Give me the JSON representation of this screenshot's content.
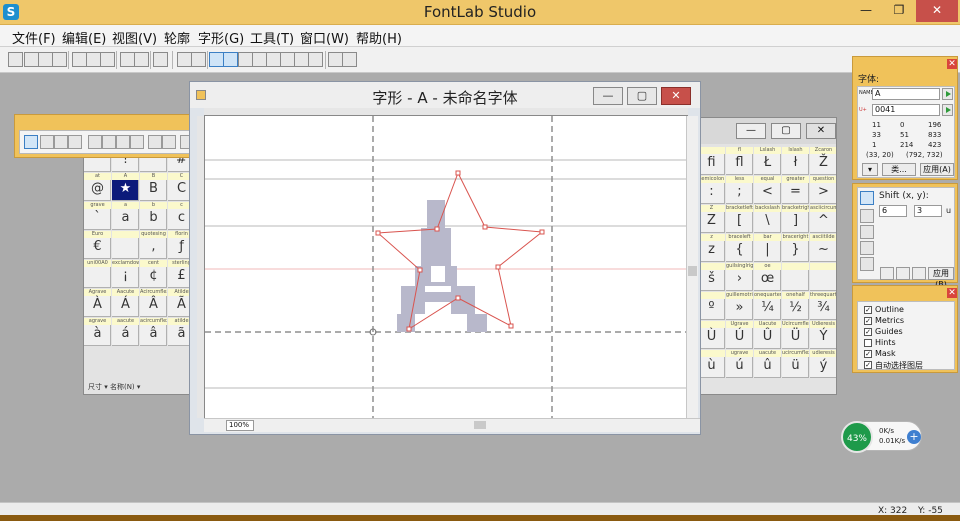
{
  "app": {
    "title": "FontLab Studio",
    "logo_letter": "S"
  },
  "window_controls": {
    "minimize": "—",
    "restore": "❐",
    "close": "✕"
  },
  "menu": [
    "文件(F)",
    "编辑(E)",
    "视图(V)",
    "轮廓",
    "字形(G)",
    "工具(T)",
    "窗口(W)",
    "帮助(H)"
  ],
  "glyph_window": {
    "title": "字形 - A - 未命名字体",
    "zoom": "100%",
    "minimize": "—",
    "restore": "▢",
    "close": "✕"
  },
  "glyph_table_left": {
    "rows": [
      {
        "names": [
          "space",
          "exclam",
          "quotedbl",
          "numbersign"
        ],
        "glyphs": [
          "",
          "!",
          "\"",
          "#"
        ]
      },
      {
        "names": [
          "at",
          "A",
          "B",
          "C"
        ],
        "glyphs": [
          "@",
          "★",
          "B",
          "C"
        ]
      },
      {
        "names": [
          "grave",
          "a",
          "b",
          "c"
        ],
        "glyphs": [
          "`",
          "a",
          "b",
          "c"
        ]
      },
      {
        "names": [
          "Euro",
          "",
          "quotesing",
          "florin"
        ],
        "glyphs": [
          "€",
          "",
          ",",
          "ƒ"
        ]
      },
      {
        "names": [
          "uni00A0",
          "exclamdown",
          "cent",
          "sterling"
        ],
        "glyphs": [
          "",
          "¡",
          "¢",
          "£"
        ]
      },
      {
        "names": [
          "Agrave",
          "Aacute",
          "Acircumflex",
          "Atilde"
        ],
        "glyphs": [
          "À",
          "Á",
          "Â",
          "Ã"
        ]
      },
      {
        "names": [
          "agrave",
          "aacute",
          "acircumflex",
          "atilde"
        ],
        "glyphs": [
          "à",
          "á",
          "â",
          "ã"
        ]
      }
    ],
    "status": "尺寸 ▾   名称(N) ▾"
  },
  "glyph_table_right": {
    "rows": [
      {
        "names": [
          "",
          "fl",
          "Lslash",
          "lslash",
          "Zcaron",
          "zcaron"
        ],
        "glyphs": [
          "fi",
          "fl",
          "Ł",
          "ł",
          "Ž",
          "ž"
        ]
      },
      {
        "names": [
          "semicolon",
          "less",
          "equal",
          "greater",
          "question"
        ],
        "glyphs": [
          ":",
          ";",
          "<",
          "=",
          ">",
          "?"
        ]
      },
      {
        "names": [
          "Z",
          "bracketleft",
          "backslash",
          "bracketright",
          "asciicircum",
          "underscore"
        ],
        "glyphs": [
          "Z",
          "[",
          "\\",
          "]",
          "^",
          "_"
        ]
      },
      {
        "names": [
          "z",
          "braceleft",
          "bar",
          "braceright",
          "asciitilde",
          ""
        ],
        "glyphs": [
          "z",
          "{",
          "|",
          "}",
          "~",
          ""
        ]
      },
      {
        "names": [
          "",
          "guilsinglright",
          "oe",
          "",
          "",
          "Ydieresis"
        ],
        "glyphs": [
          "š",
          "›",
          "œ",
          "",
          "",
          "Ÿ"
        ]
      },
      {
        "names": [
          "",
          "guillemotright",
          "onequarter",
          "onehalf",
          "threequarters",
          "questiondown"
        ],
        "glyphs": [
          "º",
          "»",
          "¼",
          "½",
          "¾",
          "¿"
        ]
      },
      {
        "names": [
          "",
          "Ugrave",
          "Uacute",
          "Ucircumflex",
          "Udieresis",
          "Yacute"
        ],
        "glyphs": [
          "Ù",
          "Ú",
          "Û",
          "Ü",
          "Ý",
          "Þ",
          "ß"
        ]
      },
      {
        "names": [
          "",
          "ugrave",
          "uacute",
          "ucircumflex",
          "udieresis",
          "yacute"
        ],
        "glyphs": [
          "ù",
          "ú",
          "û",
          "ü",
          "ý",
          "þ",
          "ÿ"
        ]
      }
    ]
  },
  "font_panel": {
    "title": "字体:",
    "name_field": "A",
    "unicode_field": "0041",
    "name_tag": "NAME",
    "unicode_tag": "U+",
    "stats": [
      "11",
      "51",
      "833",
      "33",
      "1",
      "0",
      "196",
      "214",
      "423",
      "(33, 20)",
      "(792, 732)"
    ],
    "dropdown": "类...",
    "apply_label": "应用(A)"
  },
  "shift_panel": {
    "label": "Shift (x, y):",
    "x": "6",
    "y": "3",
    "unit": "u",
    "apply_label": "应用(B)"
  },
  "layers_panel": {
    "items": [
      {
        "label": "Outline",
        "checked": true
      },
      {
        "label": "Metrics",
        "checked": true
      },
      {
        "label": "Guides",
        "checked": true
      },
      {
        "label": "Hints",
        "checked": false
      },
      {
        "label": "Mask",
        "checked": true
      },
      {
        "label": "自动选择图层",
        "checked": true
      }
    ]
  },
  "net_widget": {
    "percent": "43%",
    "up": "0K/s",
    "down": "0.01K/s",
    "plus": "+"
  },
  "status": {
    "x": "X: 322",
    "y": "Y: -55"
  }
}
